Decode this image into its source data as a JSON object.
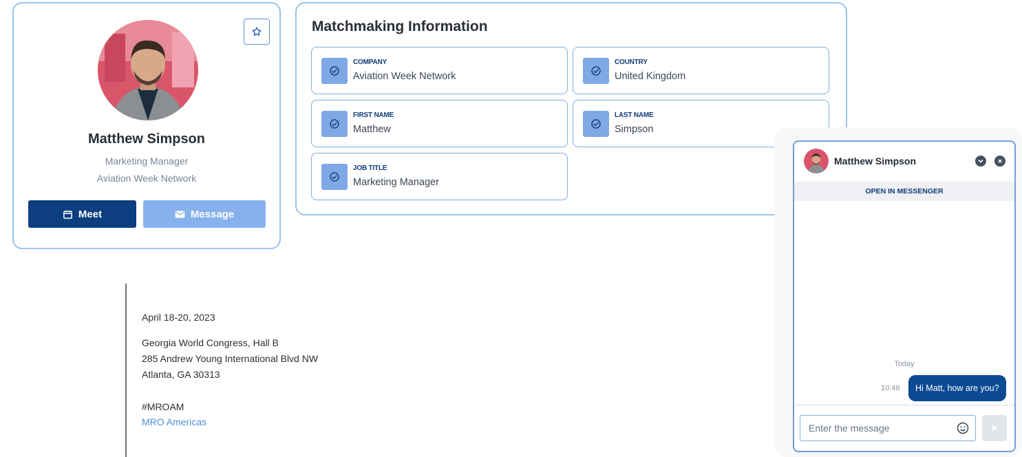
{
  "profile": {
    "name": "Matthew Simpson",
    "role": "Marketing Manager",
    "company": "Aviation Week Network",
    "meet_label": "Meet",
    "message_label": "Message"
  },
  "matchmaking": {
    "title": "Matchmaking Information",
    "fields": [
      {
        "label": "COMPANY",
        "value": "Aviation Week Network"
      },
      {
        "label": "COUNTRY",
        "value": "United Kingdom"
      },
      {
        "label": "FIRST NAME",
        "value": "Matthew"
      },
      {
        "label": "LAST NAME",
        "value": "Simpson"
      },
      {
        "label": "JOB TITLE",
        "value": "Marketing Manager"
      }
    ]
  },
  "event": {
    "dates": "April 18-20, 2023",
    "venue": "Georgia World Congress, Hall B",
    "street": "285 Andrew Young International Blvd NW",
    "city": "Atlanta, GA 30313",
    "hashtag": "#MROAM",
    "link": "MRO Americas"
  },
  "chat": {
    "name": "Matthew Simpson",
    "open_label": "OPEN IN MESSENGER",
    "day": "Today",
    "messages": [
      {
        "time": "10:48",
        "text": "Hi Matt, how are you?"
      }
    ],
    "input_placeholder": "Enter the message"
  },
  "colors": {
    "primary_dark": "#0c3e80",
    "primary_light": "#86b1ec",
    "border": "#9cc3ea",
    "link": "#4d8fd6"
  },
  "icons": [
    "star-icon",
    "calendar-icon",
    "mail-icon",
    "check-circle-icon",
    "chevron-down-icon",
    "close-icon",
    "emoji-icon",
    "send-icon"
  ]
}
